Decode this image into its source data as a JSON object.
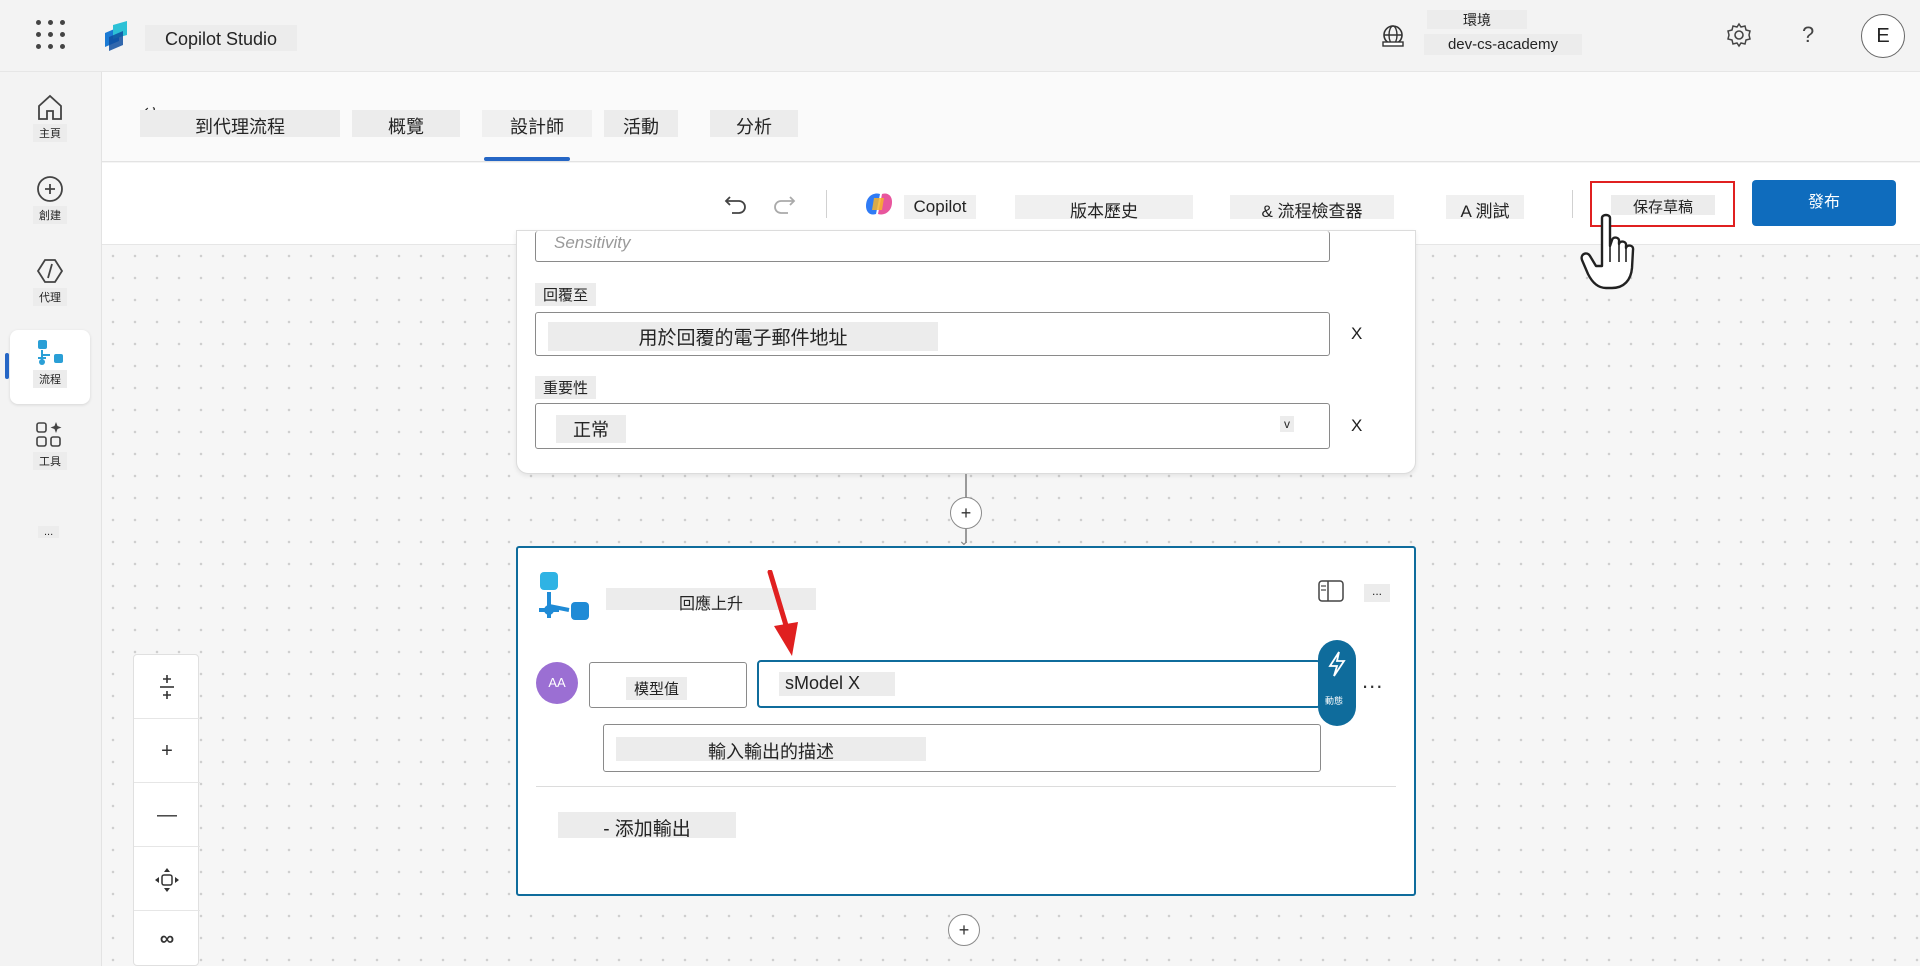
{
  "app": {
    "title": "Copilot Studio"
  },
  "environment": {
    "label": "環境",
    "name": "dev-cs-academy"
  },
  "user": {
    "initial": "E"
  },
  "left_nav": {
    "items": [
      {
        "label": "主頁",
        "icon": "home-icon"
      },
      {
        "label": "創建",
        "icon": "create-icon"
      },
      {
        "label": "代理",
        "icon": "agents-icon"
      },
      {
        "label": "流程",
        "icon": "flows-icon"
      },
      {
        "label": "工具",
        "icon": "tools-icon"
      }
    ],
    "more": "..."
  },
  "tabs": {
    "flow_name": "到代理流程",
    "items": [
      "概覽",
      "設計師",
      "活動",
      "分析"
    ],
    "active": "設計師"
  },
  "toolbar": {
    "copilot": "Copilot",
    "version_history": "版本歷史",
    "flow_checker": "& 流程檢查器",
    "test": "A 測試",
    "save_draft": "保存草稿",
    "publish": "發布"
  },
  "top_card": {
    "sensitivity_placeholder": "Sensitivity",
    "reply_to_label": "回覆至",
    "reply_to_value": "用於回覆的電子郵件地址",
    "importance_label": "重要性",
    "importance_value": "正常",
    "clear": "X",
    "dropdown_chevron": "v"
  },
  "response_card": {
    "title": "回應上升",
    "more": "...",
    "avatar_text": "AA",
    "output_name": "模型值",
    "output_value": "sModel X",
    "bolt_label": "動態",
    "description_placeholder": "輸入輸出的描述",
    "add_output": "- 添加輸出",
    "row_more": "..."
  },
  "connectors": {
    "plus": "+"
  },
  "zoom_controls": {
    "zoom_in": "+",
    "zoom_out": "—",
    "minimap": "∞"
  },
  "colors": {
    "accent": "#0f6cbd",
    "card_border": "#0f6c9c",
    "highlight": "#e02020",
    "avatar": "#9b6fd3"
  }
}
